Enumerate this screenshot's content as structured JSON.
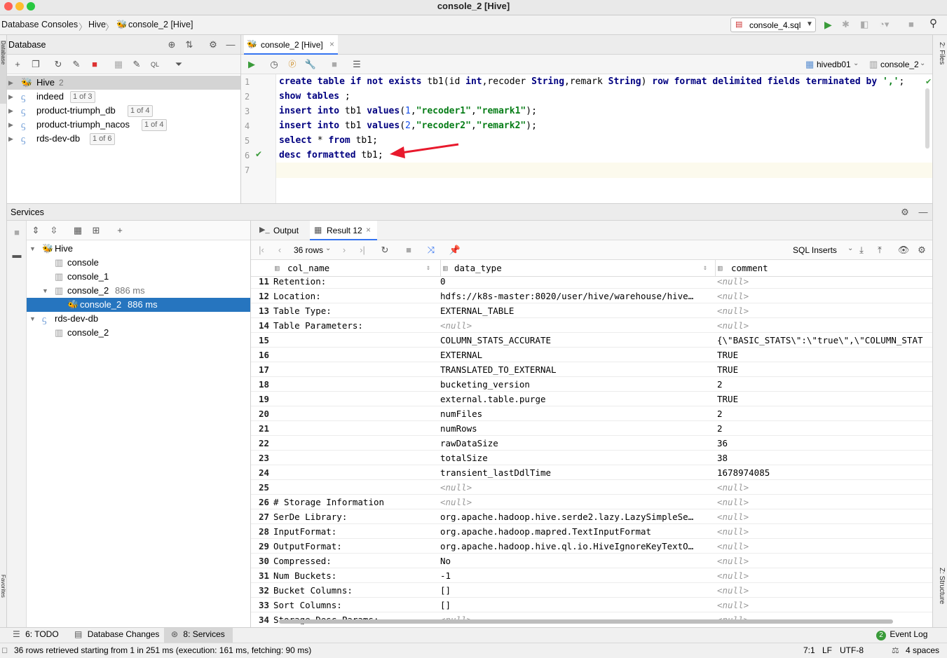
{
  "window": {
    "title": "console_2 [Hive]"
  },
  "breadcrumb": [
    "Database Consoles",
    "Hive",
    "console_2 [Hive]"
  ],
  "run_config": {
    "selected": "console_4.sql"
  },
  "database_panel": {
    "title": "Database",
    "items": [
      {
        "name": "Hive",
        "badge": "2"
      },
      {
        "name": "indeed",
        "badge": "1 of 3"
      },
      {
        "name": "product-triumph_db",
        "badge": "1 of 4"
      },
      {
        "name": "product-triumph_nacos",
        "badge": "1 of 4"
      },
      {
        "name": "rds-dev-db",
        "badge": "1 of 6"
      }
    ]
  },
  "editor": {
    "tab": "console_2 [Hive]",
    "datasource": "hivedb01",
    "session": "console_2",
    "lines": [
      "1",
      "2",
      "3",
      "4",
      "5",
      "6",
      "7"
    ]
  },
  "services": {
    "title": "Services",
    "tree": [
      {
        "label": "Hive",
        "time": ""
      },
      {
        "label": "console",
        "time": ""
      },
      {
        "label": "console_1",
        "time": ""
      },
      {
        "label": "console_2",
        "time": "886 ms"
      },
      {
        "label": "console_2",
        "time": "886 ms"
      },
      {
        "label": "rds-dev-db",
        "time": ""
      },
      {
        "label": "console_2",
        "time": ""
      }
    ],
    "tabs": [
      "Output",
      "Result 12"
    ],
    "rows_label": "36 rows",
    "sql_inserts": "SQL Inserts",
    "columns": [
      "col_name",
      "data_type",
      "comment"
    ],
    "rows": [
      [
        "11",
        "Retention:",
        "0",
        "<null>"
      ],
      [
        "12",
        "Location:",
        "hdfs://k8s-master:8020/user/hive/warehouse/hive…",
        "<null>"
      ],
      [
        "13",
        "Table Type:",
        "EXTERNAL_TABLE",
        "<null>"
      ],
      [
        "14",
        "Table Parameters:",
        "<null>",
        "<null>"
      ],
      [
        "15",
        "",
        "COLUMN_STATS_ACCURATE",
        "{\\\"BASIC_STATS\\\":\\\"true\\\",\\\"COLUMN_STAT"
      ],
      [
        "16",
        "",
        "EXTERNAL",
        "TRUE"
      ],
      [
        "17",
        "",
        "TRANSLATED_TO_EXTERNAL",
        "TRUE"
      ],
      [
        "18",
        "",
        "bucketing_version",
        "2"
      ],
      [
        "19",
        "",
        "external.table.purge",
        "TRUE"
      ],
      [
        "20",
        "",
        "numFiles",
        "2"
      ],
      [
        "21",
        "",
        "numRows",
        "2"
      ],
      [
        "22",
        "",
        "rawDataSize",
        "36"
      ],
      [
        "23",
        "",
        "totalSize",
        "38"
      ],
      [
        "24",
        "",
        "transient_lastDdlTime",
        "1678974085"
      ],
      [
        "25",
        "",
        "<null>",
        "<null>"
      ],
      [
        "26",
        "# Storage Information",
        "<null>",
        "<null>"
      ],
      [
        "27",
        "SerDe Library:",
        "org.apache.hadoop.hive.serde2.lazy.LazySimpleSe…",
        "<null>"
      ],
      [
        "28",
        "InputFormat:",
        "org.apache.hadoop.mapred.TextInputFormat",
        "<null>"
      ],
      [
        "29",
        "OutputFormat:",
        "org.apache.hadoop.hive.ql.io.HiveIgnoreKeyTextO…",
        "<null>"
      ],
      [
        "30",
        "Compressed:",
        "No",
        "<null>"
      ],
      [
        "31",
        "Num Buckets:",
        "-1",
        "<null>"
      ],
      [
        "32",
        "Bucket Columns:",
        "[]",
        "<null>"
      ],
      [
        "33",
        "Sort Columns:",
        "[]",
        "<null>"
      ],
      [
        "34",
        "Storage Desc Params:",
        "<null>",
        "<null>"
      ]
    ]
  },
  "toolwindows": {
    "todo": "6: TODO",
    "db_changes": "Database Changes",
    "services": "8: Services",
    "event_log": "Event Log",
    "event_count": "2"
  },
  "side_labels": {
    "left_top": "Database",
    "left_bottom": "Favorites",
    "right_top": "2: Files",
    "right_bottom": "Z: Structure"
  },
  "status": {
    "message": "36 rows retrieved starting from 1 in 251 ms (execution: 161 ms, fetching: 90 ms)",
    "position": "7:1",
    "line_sep": "LF",
    "encoding": "UTF-8",
    "indent": "4 spaces"
  }
}
